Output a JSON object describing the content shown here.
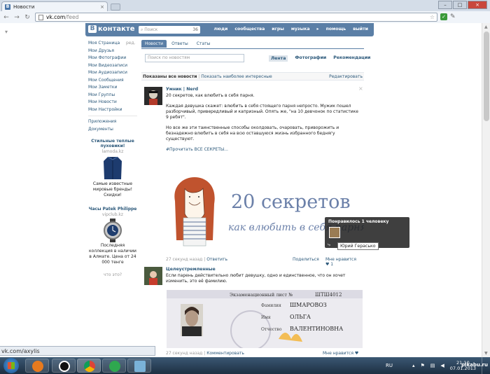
{
  "browser": {
    "tab_title": "Новости",
    "tab_close": "×",
    "url_host": "vk.com",
    "url_path": "/feed",
    "window_controls": [
      "–",
      "□",
      "×"
    ]
  },
  "vk": {
    "logo": "контакте",
    "logo_letter": "В",
    "search_placeholder": "Поиск",
    "search_count": "36",
    "menu": [
      "люди",
      "сообщества",
      "игры",
      "музыка",
      "▸",
      "помощь",
      "выйти"
    ],
    "left_menu": [
      "Моя Страница",
      "Мои Друзья",
      "Мои Фотографии",
      "Мои Видеозаписи",
      "Мои Аудиозаписи",
      "Мои Сообщения",
      "Мои Заметки",
      "Мои Группы",
      "Мои Новости",
      "Мои Настройки"
    ],
    "left_menu_edit": "ред.",
    "left_menu_extra": [
      "Приложения",
      "Документы"
    ],
    "ads": [
      {
        "title": "Стильные теплые пуховики!",
        "domain": "lamoda.kz",
        "text": "Самые известные мировые бренды! Скидки!"
      },
      {
        "title": "Часы Patek Philippe",
        "domain": "vipclub.kz",
        "text": "Последняя коллекция в наличии в Алмате. Цена от 24 000 тенге"
      }
    ],
    "whats_that": "что это?",
    "feed_tabs": [
      "Новости",
      "Ответы",
      "Статы"
    ],
    "filter_placeholder": "Поиск по новостям",
    "filter_tabs": [
      "Лента",
      "Фотографии",
      "Рекомендации"
    ],
    "showing_bold": "Показаны все новости",
    "showing_sep": "|",
    "showing_link": "Показать наиболее интересные",
    "edit_link": "Редактировать",
    "post1": {
      "author": "Умник | Nerd",
      "close": "×",
      "line1": "20 секретов, как влюбить в себя парня.",
      "para2": "Каждая девушка скажет: влюбить в себя стоящего парня непросто. Мужик пошел разборчивый, привередливый и капризный. Опять же, \"на 10 девчонок по статистике 9 ребят\".",
      "para3": "Но все же эти таинственные способы околдовать, очаровать, приворожить и безнадежно влюбить в себя на всю оставшуюся жизнь избранного беднягу существуют.",
      "readmore": "#Прочитать ВСЕ СЕКРЕТЫ...",
      "drawing_title": "20 секретов",
      "drawing_sub": "как влюбить в себя парня",
      "meta_time": "27 секунд назад",
      "meta_sep": "|",
      "meta_reply": "Ответить",
      "share": "Поделиться",
      "like": "Мне нравится ♥ 1"
    },
    "tooltip": {
      "title": "Понравилось 1 человеку",
      "name": "Юрий Гераськo"
    },
    "post2": {
      "author": "Целеустремленные",
      "text": "Если парень действительно любит девушку, одно и единственное, что он хочет изменить, это её фамилию.",
      "doc_header": "Экзаменационный лист №",
      "doc_number": "ШТШ4012",
      "doc_rows": [
        {
          "label": "Фамилия",
          "value": "ШМАРОВОЗ"
        },
        {
          "label": "Имя",
          "value": "ОЛЬГА"
        },
        {
          "label": "Отчество",
          "value": "ВАЛЕНТИНОВНА"
        }
      ],
      "meta_time": "27 секунд назад",
      "meta_sep": "|",
      "meta_reply": "Комментировать",
      "like": "Мне нравится ♥"
    }
  },
  "status_url": "vk.com/axylis",
  "taskbar": {
    "lang": "RU",
    "time": "21:10",
    "date": "07.01.2013"
  },
  "watermark": "pikabu.ru"
}
